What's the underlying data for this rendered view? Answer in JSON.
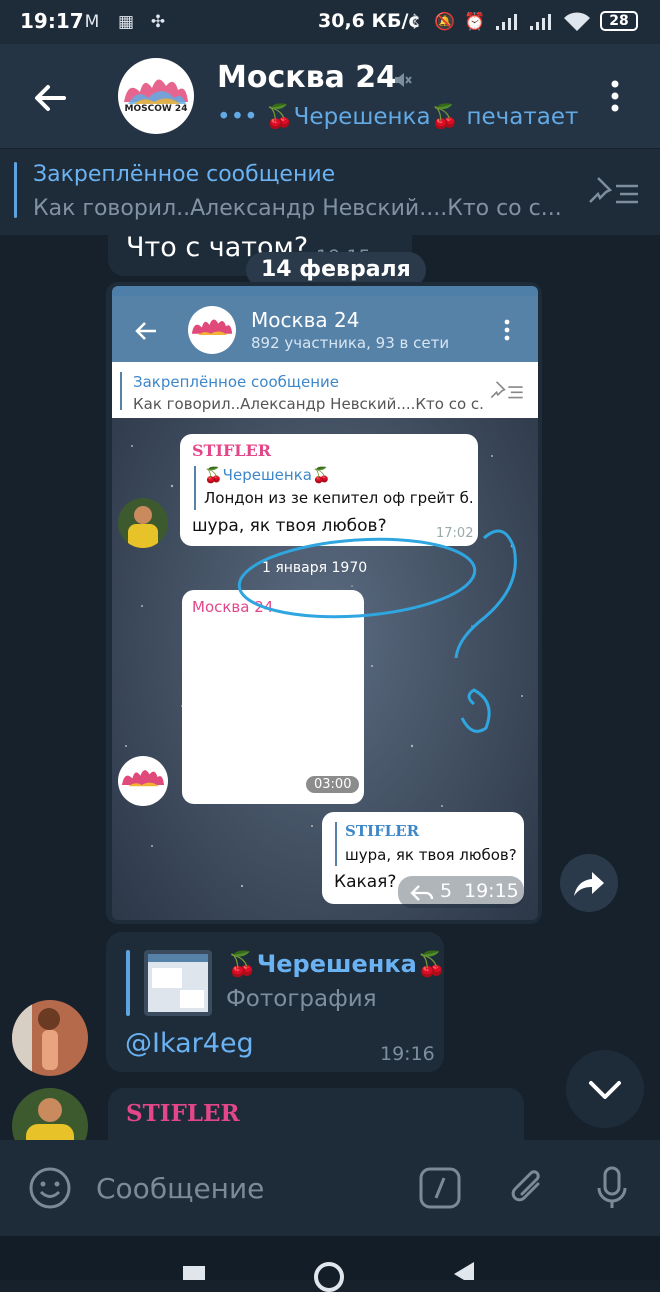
{
  "status_bar": {
    "time": "19:17",
    "network_speed": "30,6 КБ/с",
    "battery": "28"
  },
  "header": {
    "title": "Москва 24",
    "status": "••• 🍒Черешенка🍒 печатает",
    "avatar_text": "MOSCOW 24"
  },
  "pinned": {
    "title": "Закреплённое сообщение",
    "text": "Как говорил..Александр Невский....Кто со с..."
  },
  "messages": {
    "top_text": "Что с чатом?",
    "top_time": "19:15",
    "date_separator": "14 февраля",
    "screenshot": {
      "title": "Москва 24",
      "subtitle": "892 участника, 93 в сети",
      "pinned_title": "Закреплённое сообщение",
      "pinned_text": "Как говорил..Александр Невский....Кто со с...",
      "msg1_sender": "STIFLER",
      "msg1_reply_name": "🍒Черешенка🍒",
      "msg1_reply_text": "Лондон из зе кепител оф грейт б...",
      "msg1_text": "шура, як твоя любов?",
      "msg1_time": "17:02",
      "date_label": "1 января 1970",
      "msg2_sender": "Москва 24",
      "msg2_duration": "03:00",
      "msg3_sender": "STIFLER",
      "msg3_quote": "шура, як твоя любов?",
      "msg3_text": "Какая?",
      "msg3_replies": "5",
      "msg3_time": "19:15",
      "avatar_text": "MOSCOW 24"
    },
    "reply_msg": {
      "reply_name": "🍒Черешенка🍒",
      "reply_type": "Фотография",
      "text": "@Ikar4eg",
      "time": "19:16"
    },
    "last_sender": "STIFLER"
  },
  "input": {
    "placeholder": "Сообщение"
  },
  "colors": {
    "accent": "#63a9e4",
    "stifler": "#e3478a",
    "bg": "#16212c"
  }
}
